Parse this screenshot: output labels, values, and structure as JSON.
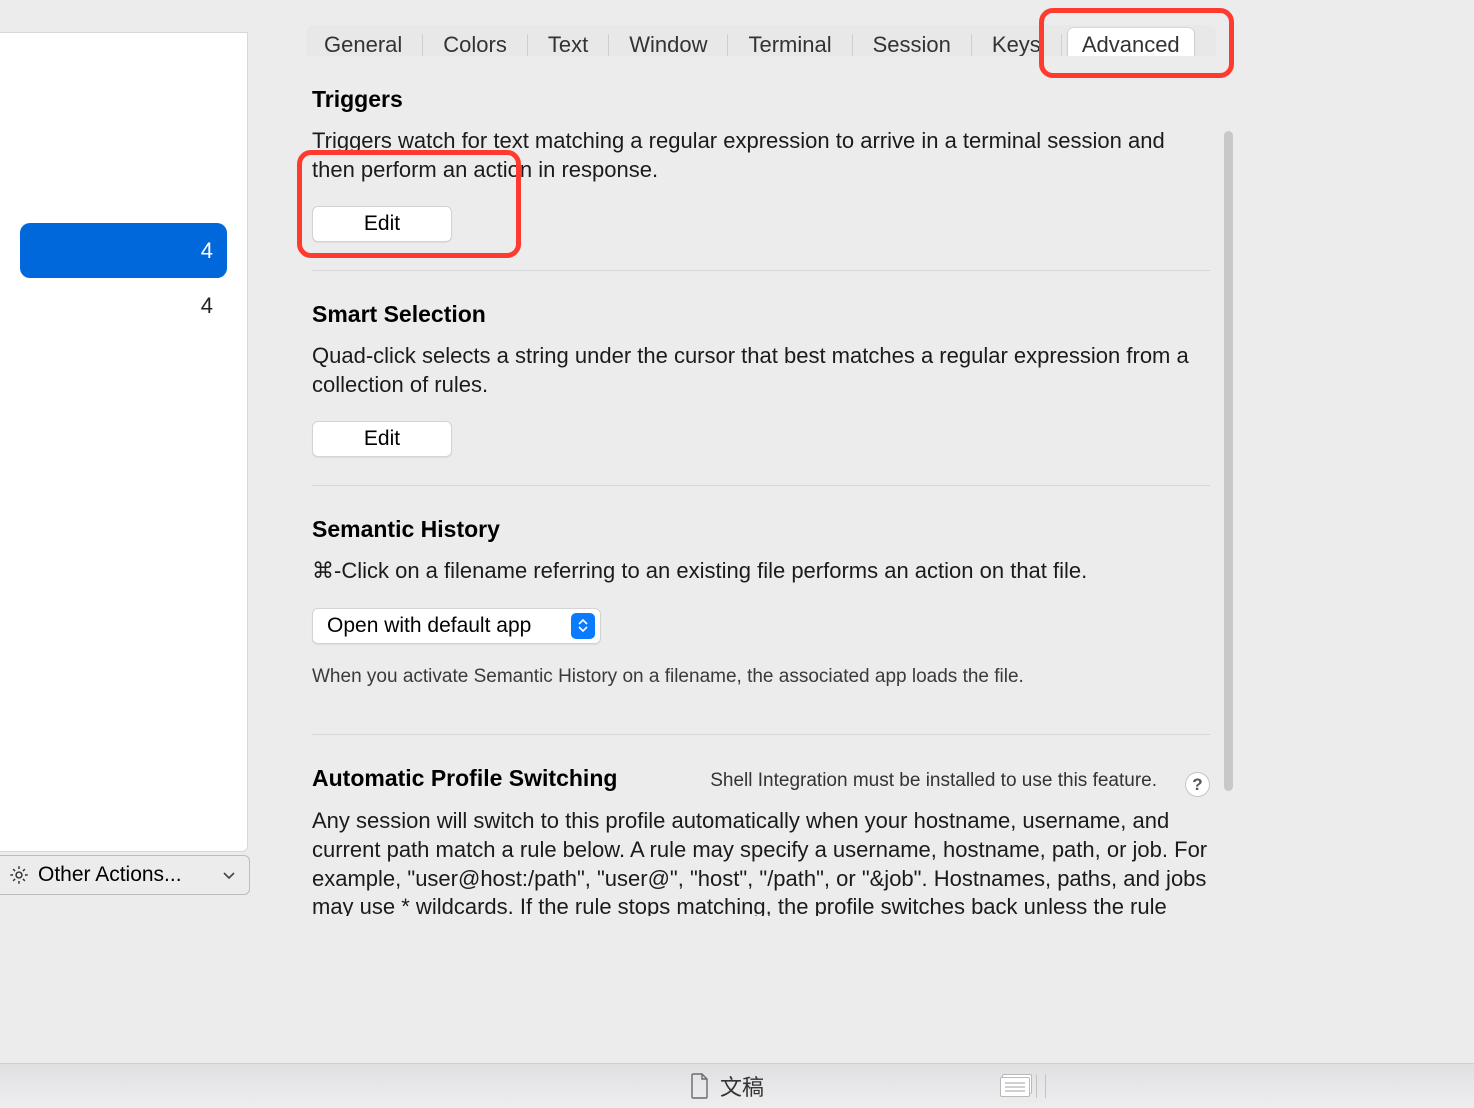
{
  "tabs": {
    "general": "General",
    "colors": "Colors",
    "text": "Text",
    "window": "Window",
    "terminal": "Terminal",
    "session": "Session",
    "keys": "Keys",
    "advanced": "Advanced"
  },
  "sidebar": {
    "items": [
      {
        "label": "4"
      },
      {
        "label": "4"
      }
    ]
  },
  "other_actions_label": "Other Actions...",
  "sections": {
    "triggers": {
      "title": "Triggers",
      "desc": "Triggers watch for text matching a regular expression to arrive in a terminal session and then perform an action in response.",
      "edit_label": "Edit"
    },
    "smart_selection": {
      "title": "Smart Selection",
      "desc": "Quad-click selects a string under the cursor that best matches a regular expression from a collection of rules.",
      "edit_label": "Edit"
    },
    "semantic_history": {
      "title": "Semantic History",
      "desc": "⌘-Click on a filename referring to an existing file performs an action on that file.",
      "select_value": "Open with default app",
      "hint": "When you activate Semantic History on a filename, the associated app loads the file."
    },
    "aps": {
      "title": "Automatic Profile Switching",
      "note": "Shell Integration must be installed to use this feature.",
      "help": "?",
      "desc": "Any session will switch to this profile automatically when your hostname, username, and current path match a rule below. A rule may specify a username, hostname, path, or job. For example, \"user@host:/path\", \"user@\", \"host\", \"/path\", or \"&job\". Hostnames, paths, and jobs may use * wildcards. If the rule stops matching, the profile switches back unless the rule begins with \"!\""
    }
  },
  "dock": {
    "item1_label": "文稿"
  }
}
